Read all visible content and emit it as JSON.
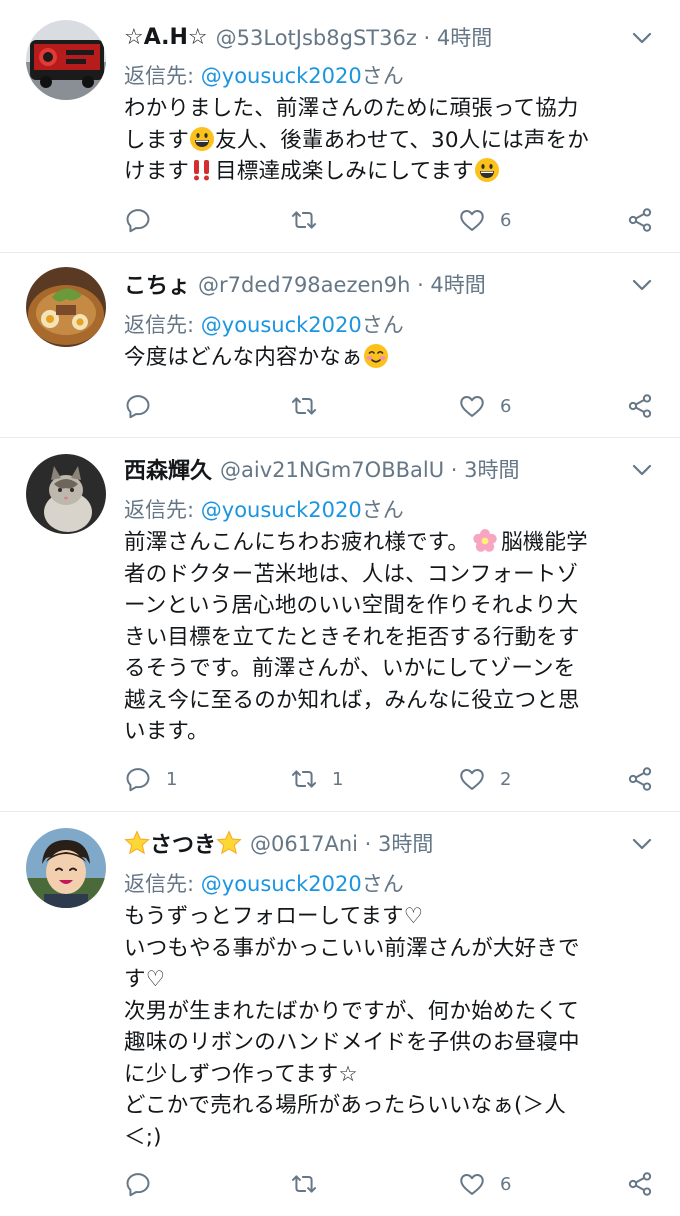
{
  "tweets": [
    {
      "display_name": "☆A.H☆",
      "handle": "@53LotJsb8gST36z",
      "time": "4時間",
      "reply_prefix": "返信先: ",
      "reply_to": "@yousuck2020",
      "reply_suffix": "さん",
      "lines": [
        "わかりました、前澤さんのために頑張って協力",
        "します",
        "友人、後輩あわせて、30人には声をか",
        "けます",
        "目標達成楽しみにしてます"
      ],
      "reply_count": "",
      "retweet_count": "",
      "like_count": "6"
    },
    {
      "display_name": "こちょ",
      "handle": "@r7ded798aezen9h",
      "time": "4時間",
      "reply_prefix": "返信先: ",
      "reply_to": "@yousuck2020",
      "reply_suffix": "さん",
      "lines": [
        "今度はどんな内容かなぁ"
      ],
      "reply_count": "",
      "retweet_count": "",
      "like_count": "6"
    },
    {
      "display_name": "西森輝久",
      "handle": "@aiv21NGm7OBBalU",
      "time": "3時間",
      "reply_prefix": "返信先: ",
      "reply_to": "@yousuck2020",
      "reply_suffix": "さん",
      "lines": [
        "前澤さんこんにちわお疲れ様です。",
        "脳機能学",
        "者のドクター苫米地は、人は、コンフォートゾ",
        "ーンという居心地のいい空間を作りそれより大",
        "きい目標を立てたときそれを拒否する行動をす",
        "るそうです。前澤さんが、いかにしてゾーンを",
        "越え今に至るのか知れば，みんなに役立つと思",
        "います。"
      ],
      "reply_count": "1",
      "retweet_count": "1",
      "like_count": "2"
    },
    {
      "display_name": "さつき",
      "handle": "@0617Ani",
      "time": "3時間",
      "reply_prefix": "返信先: ",
      "reply_to": "@yousuck2020",
      "reply_suffix": "さん",
      "lines": [
        "もうずっとフォローしてます♡",
        "いつもやる事がかっこいい前澤さんが大好きで",
        "す♡",
        "次男が生まれたばかりですが、何か始めたくて",
        "趣味のリボンのハンドメイドを子供のお昼寝中",
        "に少しずつ作ってます☆",
        "どこかで売れる場所があったらいいなぁ(＞人",
        "＜;)"
      ],
      "reply_count": "",
      "retweet_count": "",
      "like_count": "6"
    }
  ],
  "meta_separator": " · ",
  "colors": {
    "text": "#14171a",
    "secondary": "#657786",
    "link": "#1b95e0",
    "divider": "#e6ecf0"
  },
  "icons": [
    "caret-down-icon",
    "reply-icon",
    "retweet-icon",
    "like-icon",
    "share-icon",
    "grinning-emoji",
    "double-exclamation-emoji",
    "smiling-blush-emoji",
    "cherry-blossom-emoji",
    "star-emoji"
  ]
}
